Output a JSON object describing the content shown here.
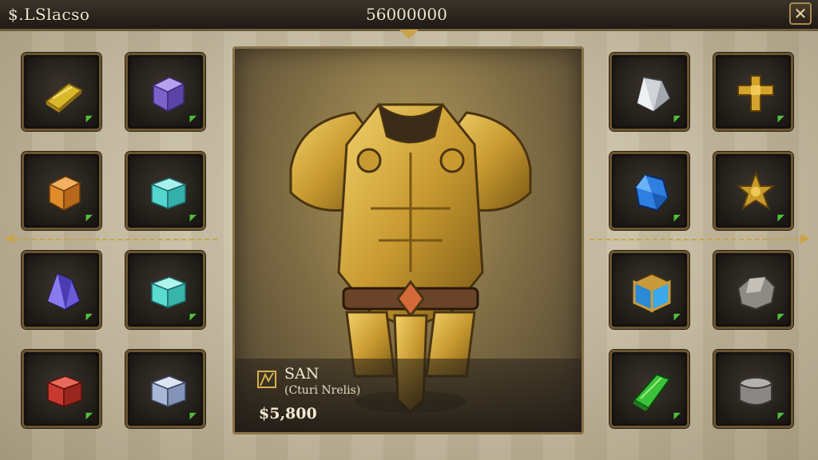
{
  "header": {
    "title": "$.LSlacso",
    "gold": "56000000",
    "close_symbol": "✕"
  },
  "selected_item": {
    "name": "SAN",
    "subtitle": "(Cturi Nrelis)",
    "price": "$5,800"
  },
  "left_slots": [
    {
      "icon": "gold-bar-icon",
      "color": "#d9b82a"
    },
    {
      "icon": "purple-cube-icon",
      "color": "#8a6fd6"
    },
    {
      "icon": "orange-cube-icon",
      "color": "#e08a2a"
    },
    {
      "icon": "cyan-cube-icon",
      "color": "#4fd6d0"
    },
    {
      "icon": "amethyst-crystal-icon",
      "color": "#6c5ad6"
    },
    {
      "icon": "cyan-cube-icon",
      "color": "#56dcd0"
    },
    {
      "icon": "red-cube-icon",
      "color": "#c83a30"
    },
    {
      "icon": "silver-cube-icon",
      "color": "#a9b8d8"
    }
  ],
  "right_slots": [
    {
      "icon": "quartz-crystal-icon",
      "color": "#d0d4d8"
    },
    {
      "icon": "gold-ornament-icon",
      "color": "#d4a32c"
    },
    {
      "icon": "sapphire-gem-icon",
      "color": "#2f7fe0"
    },
    {
      "icon": "gold-star-icon",
      "color": "#c79a2a"
    },
    {
      "icon": "framed-blue-cube-icon",
      "color": "#3aa8ec"
    },
    {
      "icon": "stone-ore-icon",
      "color": "#8e8a84"
    },
    {
      "icon": "emerald-crystal-icon",
      "color": "#3cc23a"
    },
    {
      "icon": "iron-ingot-icon",
      "color": "#8a8884"
    }
  ]
}
